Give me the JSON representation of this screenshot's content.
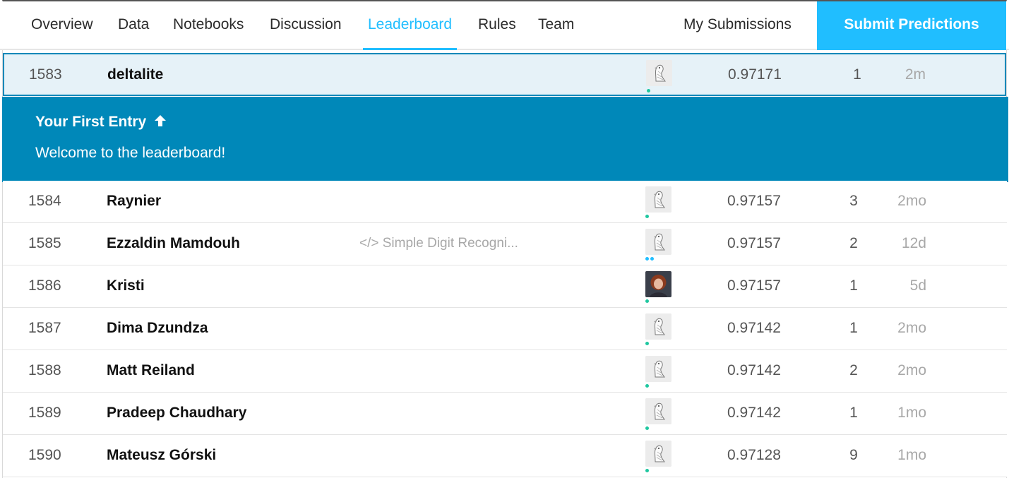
{
  "nav": {
    "tabs": [
      "Overview",
      "Data",
      "Notebooks",
      "Discussion",
      "Leaderboard",
      "Rules",
      "Team"
    ],
    "active_tab": "Leaderboard",
    "my_submissions": "My Submissions",
    "submit_predictions": "Submit Predictions"
  },
  "current_row": {
    "rank": "1583",
    "name": "deltalite",
    "kernel": "",
    "score": "0.97171",
    "entries": "1",
    "last": "2m",
    "avatar": "default-goose-avatar"
  },
  "banner": {
    "title": "Your First Entry",
    "arrow_icon": "arrow-up-icon",
    "message": "Welcome to the leaderboard!"
  },
  "rows": [
    {
      "rank": "1584",
      "name": "Raynier",
      "kernel": "",
      "score": "0.97157",
      "entries": "3",
      "last": "2mo",
      "avatar": "default-goose-avatar"
    },
    {
      "rank": "1585",
      "name": "Ezzaldin Mamdouh",
      "kernel": "</> Simple Digit Recogni...",
      "score": "0.97157",
      "entries": "2",
      "last": "12d",
      "avatar": "default-goose-avatar"
    },
    {
      "rank": "1586",
      "name": "Kristi",
      "kernel": "",
      "score": "0.97157",
      "entries": "1",
      "last": "5d",
      "avatar": "photo-avatar"
    },
    {
      "rank": "1587",
      "name": "Dima Dzundza",
      "kernel": "",
      "score": "0.97142",
      "entries": "1",
      "last": "2mo",
      "avatar": "default-goose-avatar"
    },
    {
      "rank": "1588",
      "name": "Matt Reiland",
      "kernel": "",
      "score": "0.97142",
      "entries": "2",
      "last": "2mo",
      "avatar": "default-goose-avatar"
    },
    {
      "rank": "1589",
      "name": "Pradeep Chaudhary",
      "kernel": "",
      "score": "0.97142",
      "entries": "1",
      "last": "1mo",
      "avatar": "default-goose-avatar"
    },
    {
      "rank": "1590",
      "name": "Mateusz Górski",
      "kernel": "",
      "score": "0.97128",
      "entries": "9",
      "last": "1mo",
      "avatar": "default-goose-avatar"
    }
  ],
  "colors": {
    "accent": "#20beff",
    "banner": "#0088b9",
    "highlight_row": "#e6f2f8",
    "tier_dot": "#1fc7a0"
  }
}
